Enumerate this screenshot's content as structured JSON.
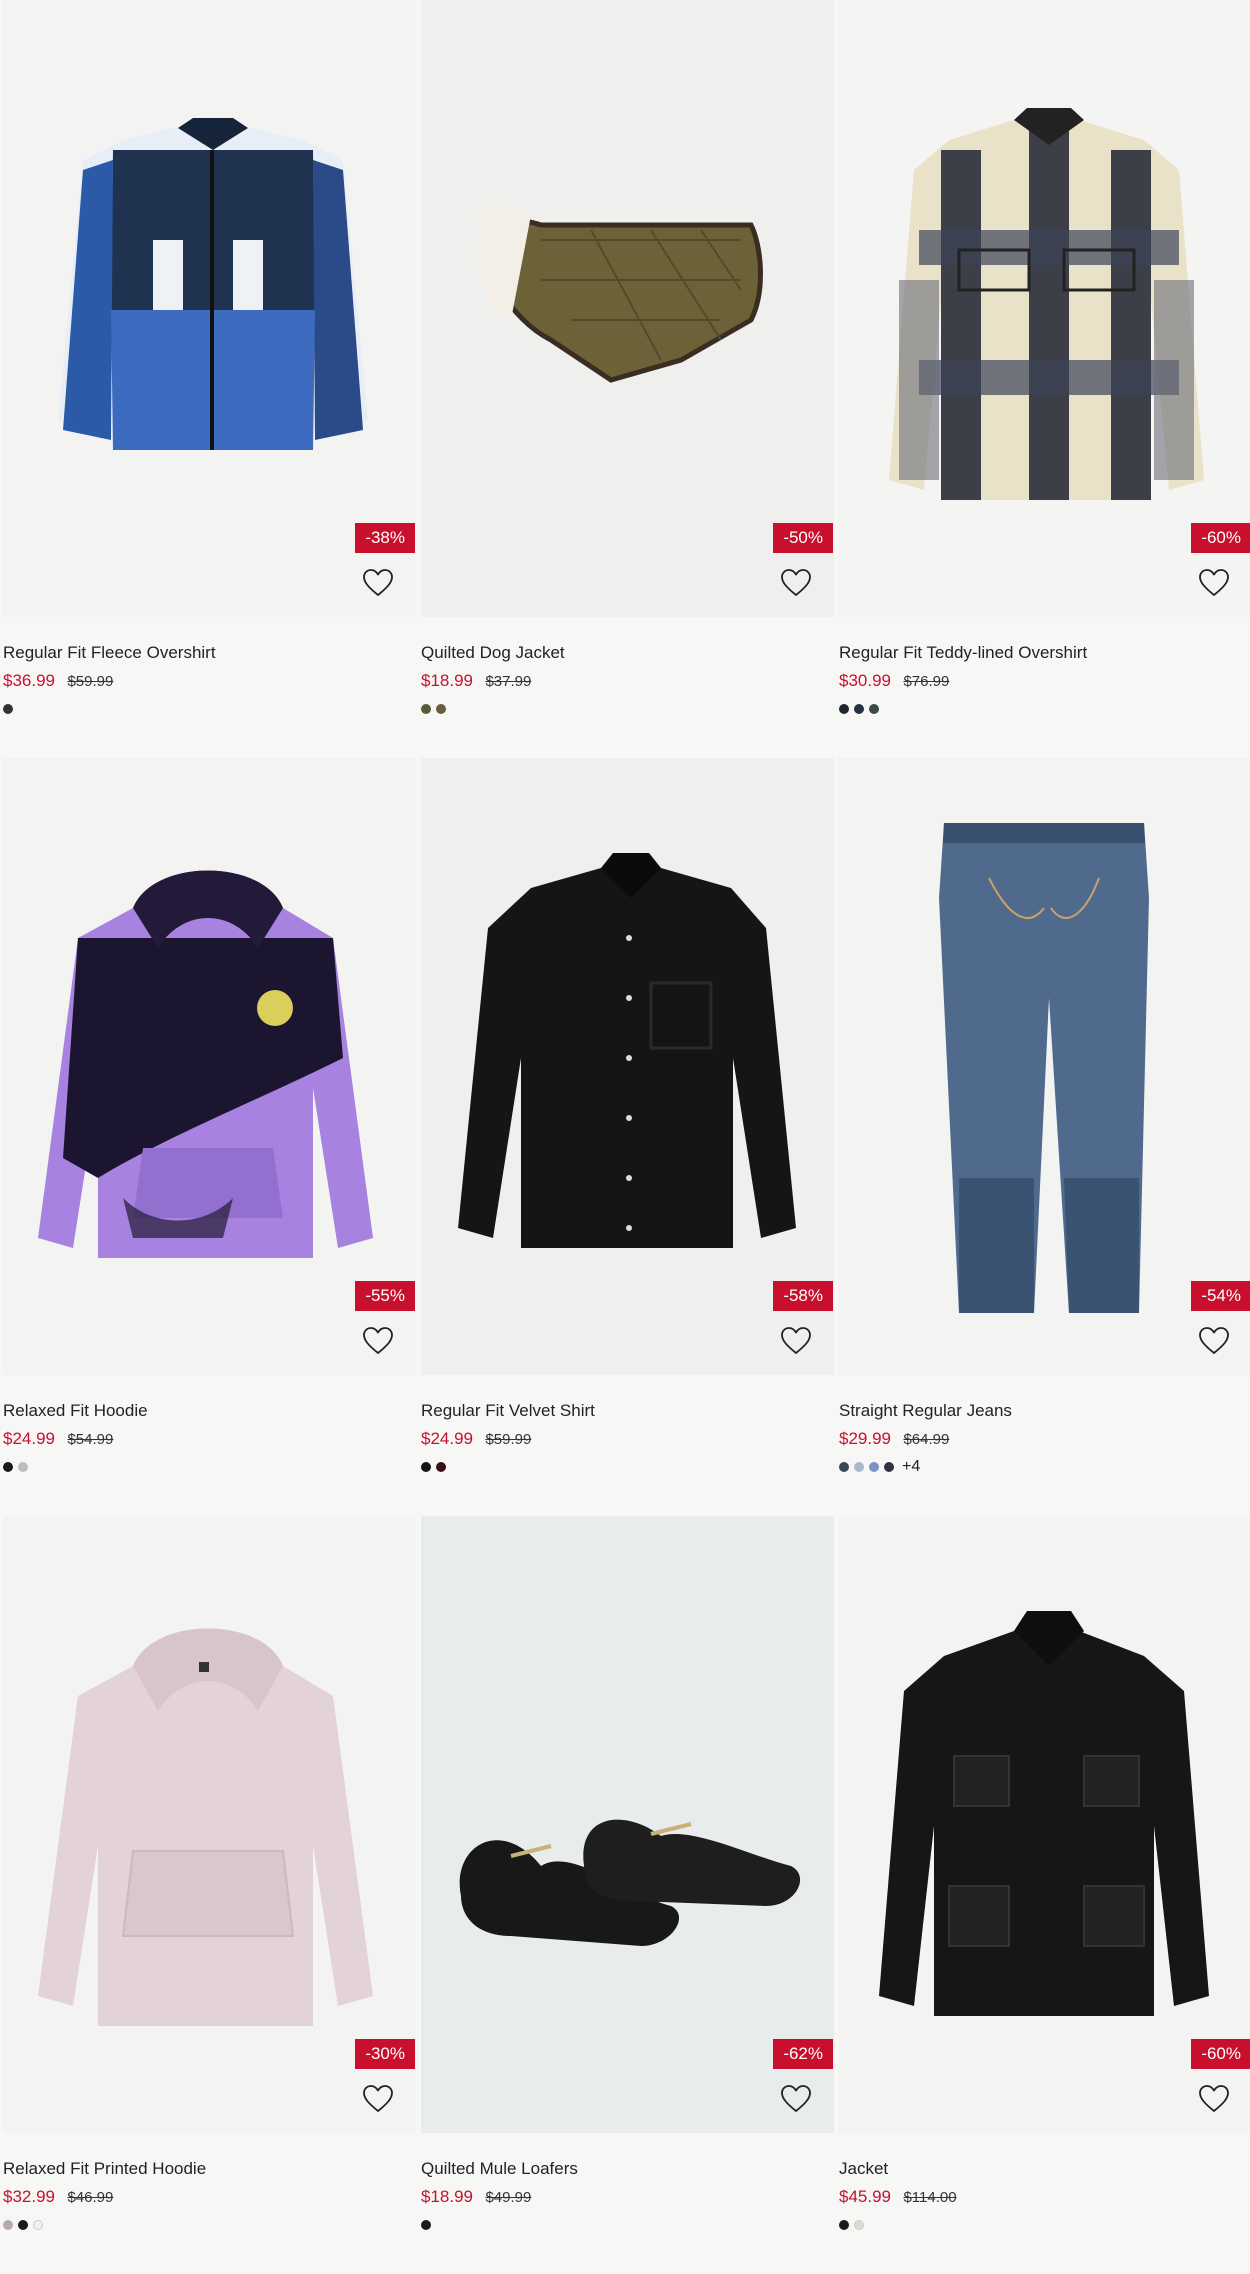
{
  "products": [
    {
      "title": "Regular Fit Fleece Overshirt",
      "price": "$36.99",
      "was": "$59.99",
      "discount": "-38%",
      "swatches": [
        "#333333"
      ],
      "more": "",
      "image_icon": "fleece-overshirt-icon",
      "bg": "#f3f3f2"
    },
    {
      "title": "Quilted Dog Jacket",
      "price": "$18.99",
      "was": "$37.99",
      "discount": "-50%",
      "swatches": [
        "#5a5a3a",
        "#6b5d3c"
      ],
      "more": "",
      "image_icon": "dog-jacket-icon",
      "bg": "#efefed"
    },
    {
      "title": "Regular Fit Teddy-lined Overshirt",
      "price": "$30.99",
      "was": "$76.99",
      "discount": "-60%",
      "swatches": [
        "#1f2630",
        "#253244",
        "#3a4a4a"
      ],
      "more": "",
      "image_icon": "plaid-overshirt-icon",
      "bg": "#f4f4f3"
    },
    {
      "title": "Relaxed Fit Hoodie",
      "price": "$24.99",
      "was": "$54.99",
      "discount": "-55%",
      "swatches": [
        "#1a1a1a",
        "#bdbdbd"
      ],
      "more": "",
      "image_icon": "tie-dye-hoodie-icon",
      "bg": "#f3f3f2"
    },
    {
      "title": "Regular Fit Velvet Shirt",
      "price": "$24.99",
      "was": "$59.99",
      "discount": "-58%",
      "swatches": [
        "#141414",
        "#3b1014"
      ],
      "more": "",
      "image_icon": "velvet-shirt-icon",
      "bg": "#eef0ef"
    },
    {
      "title": "Straight Regular Jeans",
      "price": "$29.99",
      "was": "$64.99",
      "discount": "-54%",
      "swatches": [
        "#3b4656",
        "#aab8cc",
        "#7b93c4",
        "#2f3440"
      ],
      "more": "+4",
      "image_icon": "jeans-icon",
      "bg": "#f3f3f2"
    },
    {
      "title": "Relaxed Fit Printed Hoodie",
      "price": "$32.99",
      "was": "$46.99",
      "discount": "-30%",
      "swatches": [
        "#b9a8ae",
        "#1a1a1a",
        "#f1f1f1"
      ],
      "more": "",
      "image_icon": "pink-hoodie-icon",
      "bg": "#f3f3f2"
    },
    {
      "title": "Quilted Mule Loafers",
      "price": "$18.99",
      "was": "$49.99",
      "discount": "-62%",
      "swatches": [
        "#1a1a1a"
      ],
      "more": "",
      "image_icon": "mule-loafers-icon",
      "bg": "#e9ecec"
    },
    {
      "title": "Jacket",
      "price": "$45.99",
      "was": "$114.00",
      "discount": "-60%",
      "swatches": [
        "#1a1a1a",
        "#dedbd2"
      ],
      "more": "",
      "image_icon": "leather-jacket-icon",
      "bg": "#f3f3f2"
    }
  ],
  "colors": {
    "sale_red": "#c8102e",
    "page_bg": "#f7f7f6"
  },
  "favorite_icon": "heart-outline-icon"
}
